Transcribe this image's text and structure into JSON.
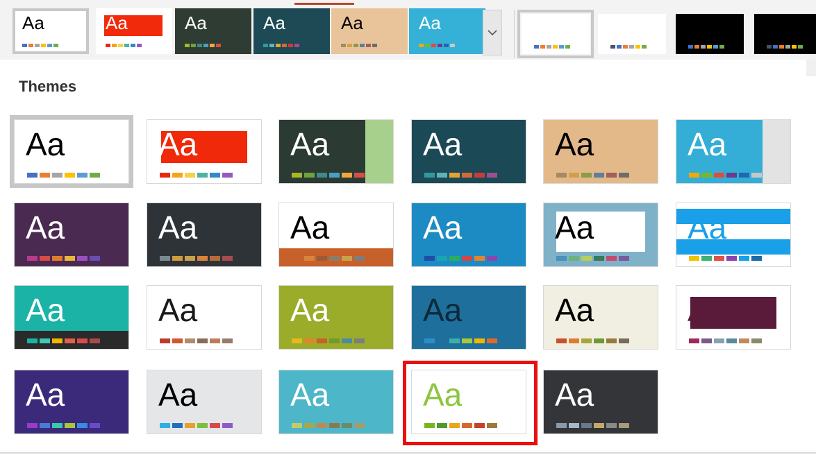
{
  "ribbon": {
    "themes": [
      {
        "aa": "Aa",
        "bg": "#ffffff",
        "fg": "#000000",
        "selected": true,
        "sw": [
          "#4472c4",
          "#ed7d31",
          "#a5a5a5",
          "#ffc000",
          "#5b9bd5",
          "#70ad47"
        ]
      },
      {
        "aa": "Aa",
        "bg": "#ffffff",
        "fg": "#ffffff",
        "band": "#f02a0a",
        "sw": [
          "#e9290f",
          "#f7a31c",
          "#f6d14a",
          "#4bb3a0",
          "#2f8bc9",
          "#9b57c0"
        ]
      },
      {
        "aa": "Aa",
        "bg": "#2f3c34",
        "fg": "#ffffff",
        "sw": [
          "#a6b727",
          "#6ea33d",
          "#3f8a84",
          "#48a0c4",
          "#f3a640",
          "#d64f43"
        ]
      },
      {
        "aa": "Aa",
        "bg": "#1d4a55",
        "fg": "#ffffff",
        "sw": [
          "#2f9a9d",
          "#5fb3b7",
          "#e5a232",
          "#d46a31",
          "#cd3a3a",
          "#9d4f8e"
        ]
      },
      {
        "aa": "Aa",
        "bg": "#e9c49a",
        "fg": "#000000",
        "sw": [
          "#a58a63",
          "#d29f49",
          "#8b9b4a",
          "#5f7f9e",
          "#a35f5a",
          "#6d6d6d"
        ]
      },
      {
        "aa": "Aa",
        "bg": "#35b0d7",
        "fg": "#ffffff",
        "sw": [
          "#f2a900",
          "#76b82a",
          "#e24c3f",
          "#6a3c8c",
          "#1e6ab1",
          "#c7c7c7"
        ]
      }
    ],
    "variants": [
      {
        "bg": "#ffffff",
        "selected": true,
        "sw": [
          "#4472c4",
          "#ed7d31",
          "#a5a5a5",
          "#ffc000",
          "#5b9bd5",
          "#70ad47"
        ]
      },
      {
        "bg": "#ffffff",
        "sw": [
          "#44546a",
          "#4472c4",
          "#ed7d31",
          "#a5a5a5",
          "#ffc000",
          "#70ad47"
        ]
      },
      {
        "bg": "#000000",
        "sw": [
          "#4472c4",
          "#ed7d31",
          "#a5a5a5",
          "#ffc000",
          "#5b9bd5",
          "#70ad47"
        ]
      },
      {
        "bg": "#000000",
        "sw": [
          "#44546a",
          "#4472c4",
          "#ed7d31",
          "#a5a5a5",
          "#ffc000",
          "#70ad47"
        ]
      }
    ]
  },
  "panel": {
    "heading": "Themes"
  },
  "themes": [
    {
      "aa": "Aa",
      "bg": "#ffffff",
      "fg": "#000000",
      "sw": [
        "#4472c4",
        "#ed7d31",
        "#a5a5a5",
        "#ffc000",
        "#5b9bd5",
        "#70ad47"
      ]
    },
    {
      "aa": "Aa",
      "bg": "#ffffff",
      "fg": "#ffffff",
      "band": "#f0290a",
      "sw": [
        "#e9290f",
        "#f7a31c",
        "#f6d14a",
        "#4bb3a0",
        "#2f8bc9",
        "#9b57c0"
      ]
    },
    {
      "aa": "Aa",
      "bg": "#2b3a33",
      "fg": "#ffffff",
      "side": "#a8d08d",
      "sw": [
        "#a6b727",
        "#6ea33d",
        "#3f8a84",
        "#48a0c4",
        "#f3a640",
        "#d64f43"
      ]
    },
    {
      "aa": "Aa",
      "bg": "#1b4a56",
      "fg": "#ffffff",
      "sw": [
        "#2f9a9d",
        "#5fb3b7",
        "#e5a232",
        "#d46a31",
        "#cd3a3a",
        "#9d4f8e"
      ]
    },
    {
      "aa": "Aa",
      "bg": "#e4b98a",
      "fg": "#000000",
      "sw": [
        "#a58a63",
        "#d29f49",
        "#8b9b4a",
        "#5f7f9e",
        "#a35f5a",
        "#6d6d6d"
      ]
    },
    {
      "aa": "Aa",
      "bg": "#34aed6",
      "fg": "#ffffff",
      "side": "#e3e3e3",
      "sw": [
        "#f2a900",
        "#76b82a",
        "#e24c3f",
        "#6a3c8c",
        "#1e6ab1",
        "#c7c7c7"
      ]
    },
    {
      "aa": "Aa",
      "bg": "#4a2a50",
      "fg": "#ffffff",
      "sw": [
        "#b83b8b",
        "#d84a4a",
        "#e07b2e",
        "#e6b53b",
        "#9b4fc1",
        "#6b4bb5"
      ]
    },
    {
      "aa": "Aa",
      "bg": "#2e3338",
      "fg": "#ffffff",
      "sw": [
        "#7a8a8f",
        "#d19a3b",
        "#c9a14a",
        "#d8823b",
        "#b76a3a",
        "#a84b4b"
      ]
    },
    {
      "aa": "Aa",
      "bg": "#ffffff",
      "fg": "#000000",
      "foot": "#c8602a",
      "sw": [
        "#c8602a",
        "#d8823b",
        "#9c5a3c",
        "#8a7d6a",
        "#c9a14a",
        "#7d7d7d"
      ]
    },
    {
      "aa": "Aa",
      "bg": "#1d8bc3",
      "fg": "#ffffff",
      "sw": [
        "#1e4fa6",
        "#1aa3b5",
        "#27ae60",
        "#d14646",
        "#e0842e",
        "#8e44ad"
      ]
    },
    {
      "aa": "Aa",
      "bg": "#7fb2c8",
      "fg": "#000000",
      "inner": "#ffffff",
      "sw": [
        "#4a90b8",
        "#6cb27a",
        "#b7ce5a",
        "#3a7a5a",
        "#c74a6e",
        "#7a5a9a"
      ]
    },
    {
      "aa": "Aa",
      "bg": "#ffffff",
      "fg": "#1aa0e8",
      "stripe": "#1aa0e8",
      "sw": [
        "#f2c200",
        "#3cb371",
        "#e0504a",
        "#8e44ad",
        "#1aa0e8",
        "#1b6ca8"
      ]
    },
    {
      "aa": "Aa",
      "bg": "#1ab3a6",
      "fg": "#ffffff",
      "foot": "#2a2a2a",
      "sw": [
        "#1ab3a6",
        "#3dc9b8",
        "#f2b705",
        "#e2604a",
        "#d84a4a",
        "#a84b4b"
      ]
    },
    {
      "aa": "Aa",
      "bg": "#ffffff",
      "fg": "#1a1a1a",
      "sw": [
        "#c0392b",
        "#d4552e",
        "#b28c6a",
        "#8c6a5a",
        "#c07a5a",
        "#9a7a6a"
      ]
    },
    {
      "aa": "Aa",
      "bg": "#9aac2a",
      "fg": "#ffffff",
      "sw": [
        "#e7b81c",
        "#e0842e",
        "#c8602a",
        "#6f9a2e",
        "#4c8a9e",
        "#7d7d7d"
      ]
    },
    {
      "aa": "Aa",
      "bg": "#1f6f9c",
      "fg": "#0c2a3a",
      "sw": [
        "#2a8fc9",
        "#1f6f9c",
        "#3cb0a8",
        "#a8c83a",
        "#f2b705",
        "#e06a2a"
      ]
    },
    {
      "aa": "Aa",
      "bg": "#f1efe2",
      "fg": "#000000",
      "sw": [
        "#c8502a",
        "#e07b2e",
        "#a6a63a",
        "#6f9a2e",
        "#9a7a3a",
        "#7a6a5a"
      ]
    },
    {
      "aa": "Aa",
      "bg": "#ffffff",
      "fg": "#5a1a3a",
      "band": "#5a1a3a",
      "sw": [
        "#9c2a5a",
        "#7a5a8a",
        "#8aa0b0",
        "#5a8a9a",
        "#c08a5a",
        "#8a8a6a"
      ]
    },
    {
      "aa": "Aa",
      "bg": "#3b2a7a",
      "fg": "#ffffff",
      "sw": [
        "#9b3bc9",
        "#4a7ad8",
        "#3ac9a8",
        "#a8c83a",
        "#3a8ae8",
        "#6a4ac9"
      ]
    },
    {
      "aa": "Aa",
      "bg": "#e4e6e8",
      "fg": "#000000",
      "sw": [
        "#2ab0e8",
        "#1f6fbf",
        "#e8a02a",
        "#7ac03a",
        "#d84a4a",
        "#8a5ac9"
      ]
    },
    {
      "aa": "Aa",
      "bg": "#4db6c9",
      "fg": "#ffffff",
      "sw": [
        "#c8c86a",
        "#a8a84a",
        "#c08a4a",
        "#8a7a4a",
        "#6a8a6a",
        "#a89a6a"
      ]
    },
    {
      "aa": "Aa",
      "bg": "#ffffff",
      "fg": "#8cc63f",
      "sw": [
        "#7ab51d",
        "#4c9a2a",
        "#e8a61a",
        "#d8682a",
        "#c8402a",
        "#9a7a3a"
      ]
    },
    {
      "aa": "Aa",
      "bg": "#333538",
      "fg": "#ffffff",
      "sw": [
        "#8a9aa8",
        "#a8b8c8",
        "#6a7a8a",
        "#c8a86a",
        "#8a8a8a",
        "#a89a7a"
      ]
    }
  ]
}
